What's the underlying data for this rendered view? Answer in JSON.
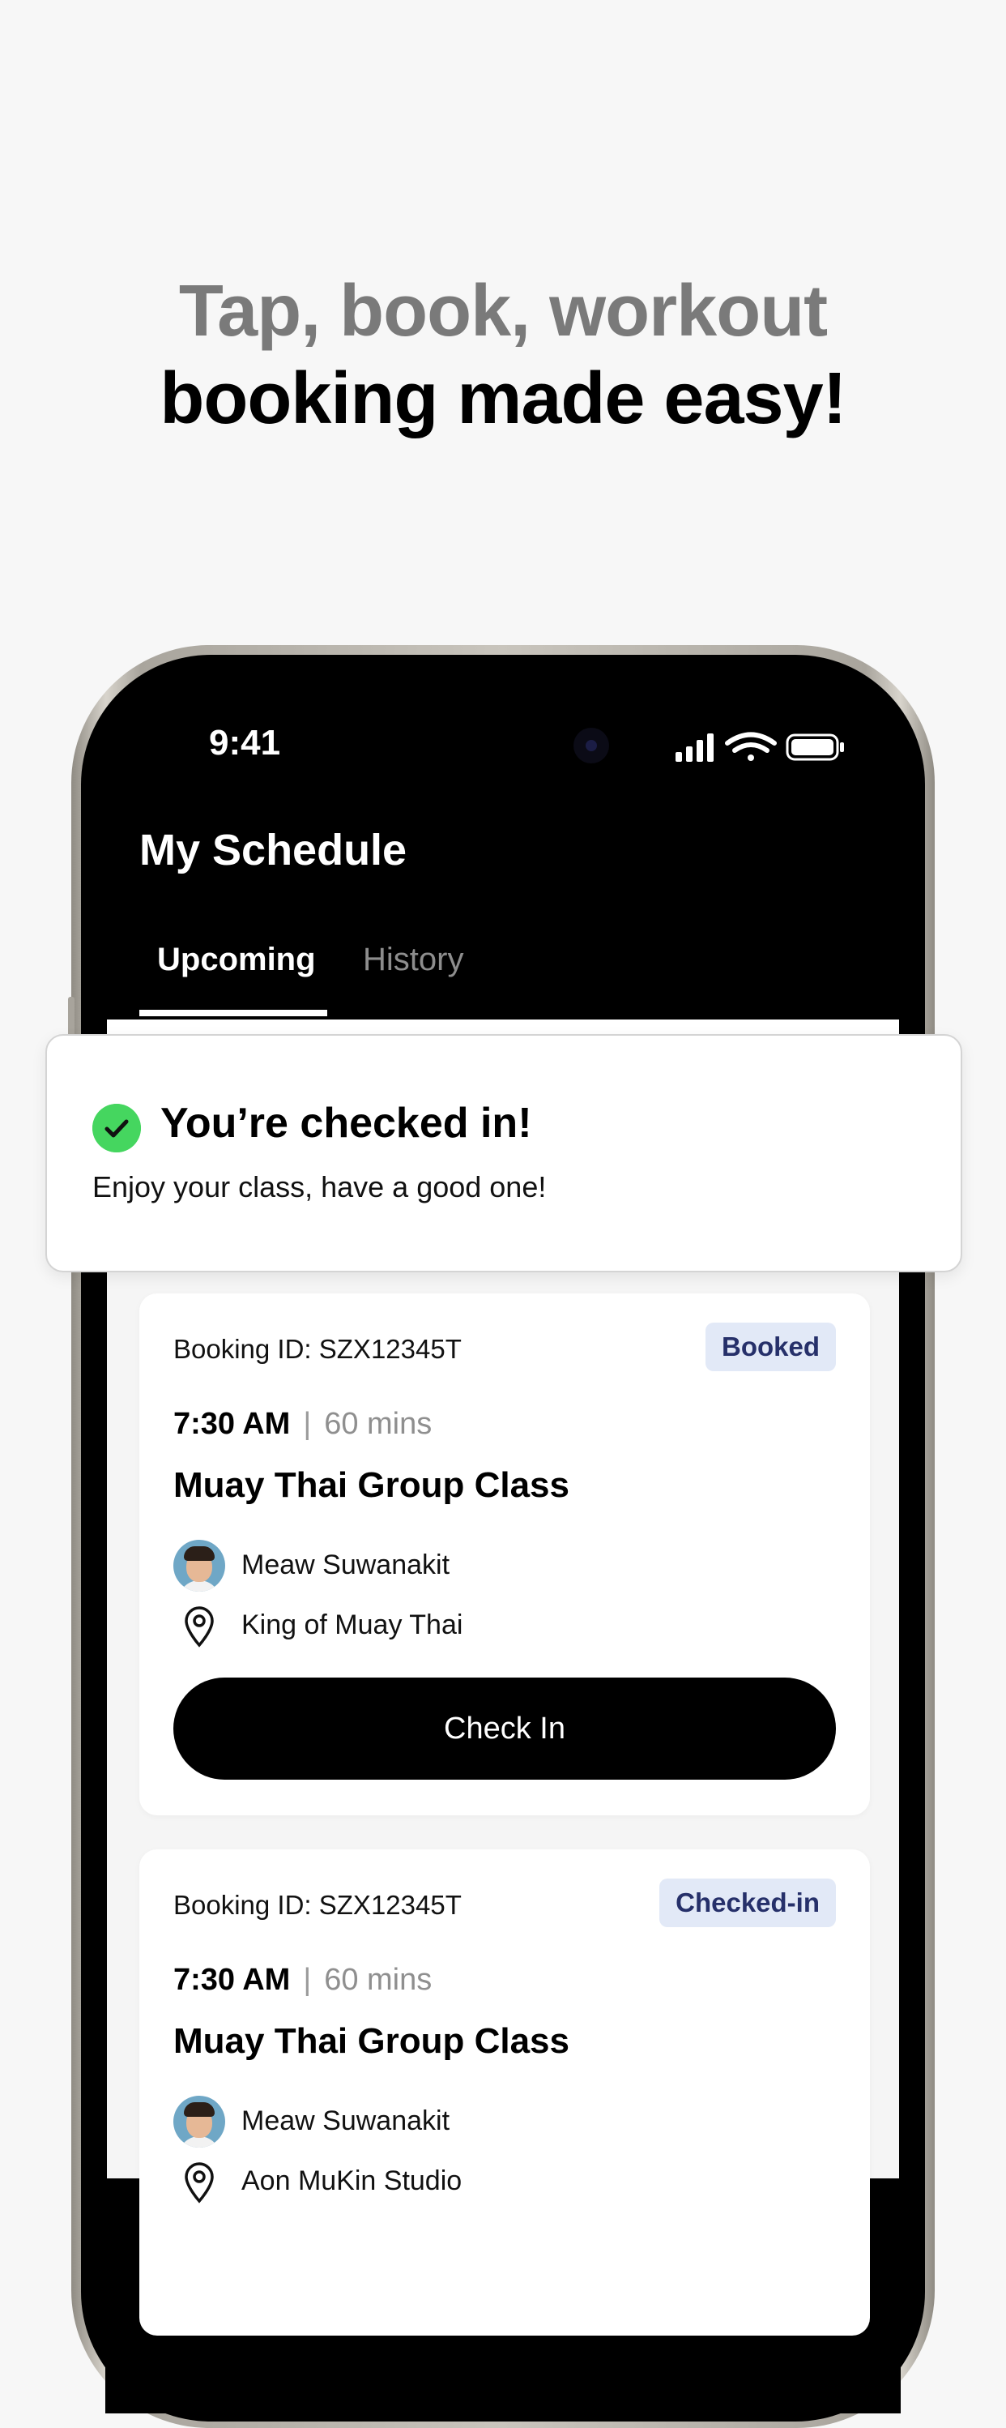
{
  "headline": {
    "line1": "Tap, book, workout",
    "line2": "booking made easy!"
  },
  "status_bar": {
    "time": "9:41",
    "icons": [
      "cellular-signal-icon",
      "wifi-icon",
      "battery-icon"
    ]
  },
  "screen": {
    "title": "My Schedule",
    "tabs": [
      {
        "label": "Upcoming",
        "active": true
      },
      {
        "label": "History",
        "active": false
      }
    ]
  },
  "toast": {
    "title": "You’re checked in!",
    "message": "Enjoy your class, have a good one!",
    "icon": "check-circle-icon",
    "icon_color": "#45d65f"
  },
  "bookings": [
    {
      "booking_id": "Booking ID: SZX12345T",
      "status": "Booked",
      "time": "7:30 AM",
      "separator": "|",
      "duration": "60 mins",
      "class_name": "Muay Thai Group Class",
      "instructor": "Meaw Suwanakit",
      "location": "King of Muay Thai",
      "action_label": "Check In"
    },
    {
      "booking_id": "Booking ID: SZX12345T",
      "status": "Checked-in",
      "time": "7:30 AM",
      "separator": "|",
      "duration": "60 mins",
      "class_name": "Muay Thai Group Class",
      "instructor": "Meaw Suwanakit",
      "location": "Aon MuKin Studio"
    }
  ],
  "colors": {
    "background": "#f7f7f7",
    "headline_muted": "#7a7a7a",
    "badge_bg": "#e2e9f7",
    "badge_text": "#26306a",
    "success": "#45d65f"
  }
}
